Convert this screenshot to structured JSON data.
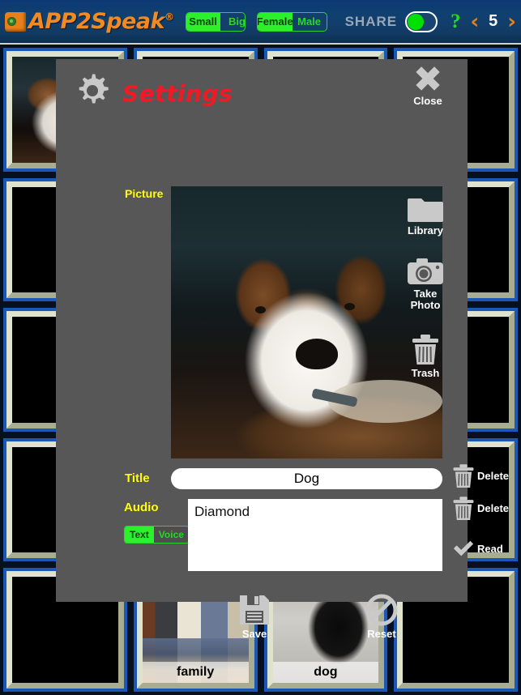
{
  "app": {
    "logo_text": "APP2Speak",
    "logo_registered": "®",
    "logo_icon": "app-logo-icon"
  },
  "topbar": {
    "size_toggle": {
      "options": [
        "Small",
        "Big"
      ],
      "selected": "Small"
    },
    "voice_toggle": {
      "options": [
        "Female",
        "Male"
      ],
      "selected": "Female"
    },
    "share_label": "SHARE",
    "share_toggle_state": "on",
    "help_label": "?",
    "prev_arrow": "‹",
    "next_arrow": "›",
    "page_number": "5",
    "colors": {
      "accent_orange": "#f08a22",
      "green": "#2bf02b",
      "bar_blue": "#10406f"
    }
  },
  "dialog": {
    "title": "Settings",
    "title_color": "#ef1b24",
    "gear_icon": "gear-icon",
    "close": {
      "label": "Close",
      "icon": "close-x-icon"
    },
    "picture_label": "Picture",
    "picture_alt": "Brown and white dog looking at camera",
    "side_actions": [
      {
        "label": "Library",
        "icon": "folder-icon"
      },
      {
        "label": "Take\nPhoto",
        "label_line1": "Take",
        "label_line2": "Photo",
        "icon": "camera-icon"
      },
      {
        "label": "Trash",
        "icon": "trash-icon"
      }
    ],
    "title_field": {
      "label": "Title",
      "value": "Dog",
      "placeholder": "",
      "delete_label": "Delete",
      "delete_icon": "trash-icon"
    },
    "audio_field": {
      "label": "Audio",
      "value": "Diamond",
      "placeholder": "",
      "mode_toggle": {
        "options": [
          "Text",
          "Voice"
        ],
        "selected": "Text"
      },
      "delete_label": "Delete",
      "delete_icon": "trash-icon",
      "read_label": "Read",
      "read_icon": "checkmark-icon"
    },
    "footer_actions": [
      {
        "label": "Save",
        "icon": "floppy-disk-icon"
      },
      {
        "label": "Reset",
        "icon": "no-entry-icon"
      }
    ],
    "background_color": "#575757"
  },
  "grid": {
    "columns": 4,
    "rows": 5,
    "cells": [
      {
        "label": "",
        "photo": "dog1",
        "empty": false
      },
      {
        "label": "",
        "photo": "",
        "empty": true
      },
      {
        "label": "",
        "photo": "",
        "empty": true
      },
      {
        "label": "",
        "photo": "",
        "empty": true
      },
      {
        "label": "",
        "photo": "",
        "empty": true
      },
      {
        "label": "",
        "photo": "",
        "empty": true
      },
      {
        "label": "",
        "photo": "",
        "empty": true
      },
      {
        "label": "",
        "photo": "",
        "empty": true
      },
      {
        "label": "",
        "photo": "",
        "empty": true
      },
      {
        "label": "",
        "photo": "",
        "empty": true
      },
      {
        "label": "",
        "photo": "",
        "empty": true
      },
      {
        "label": "",
        "photo": "",
        "empty": true
      },
      {
        "label": "",
        "photo": "",
        "empty": true
      },
      {
        "label": "",
        "photo": "",
        "empty": true
      },
      {
        "label": "",
        "photo": "",
        "empty": true
      },
      {
        "label": "",
        "photo": "",
        "empty": true
      },
      {
        "label": "",
        "photo": "",
        "empty": true
      },
      {
        "label": "family",
        "photo": "family",
        "empty": false
      },
      {
        "label": "dog",
        "photo": "dog2",
        "empty": false
      },
      {
        "label": "",
        "photo": "",
        "empty": true
      }
    ],
    "cell_border_color": "#1b58b5",
    "cell_bevel_color": "#c7cbb0"
  }
}
